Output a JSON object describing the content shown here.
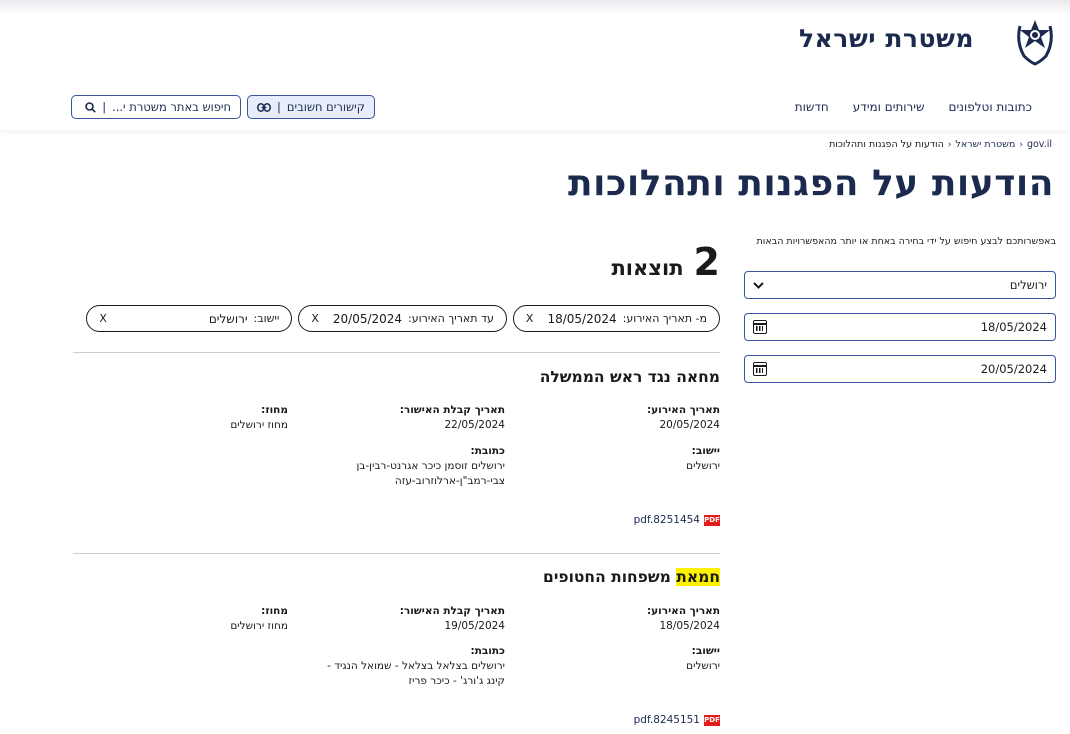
{
  "header": {
    "logo_text": "משטרת ישראל",
    "nav": [
      "כתובות וטלפונים",
      "שירותים ומידע",
      "חדשות"
    ],
    "links_button": "קישורים חשובים",
    "search_button": "חיפוש באתר משטרת י..."
  },
  "breadcrumb": [
    "gov.il",
    "משטרת ישראל",
    "הודעות על הפגנות ותהלוכות"
  ],
  "page_title": "הודעות על הפגנות ותהלוכות",
  "sidebar": {
    "hint": "באפשרותכם לבצע חיפוש על ידי בחירה באחת או יותר מהאפשרויות הבאות",
    "settlement_select": "ירושלים",
    "date_from": "18/05/2024",
    "date_to": "20/05/2024"
  },
  "results": {
    "count": "2",
    "label": "תוצאות"
  },
  "chips": [
    {
      "label": "מ- תאריך האירוע:",
      "value": "18/05/2024",
      "close": "X"
    },
    {
      "label": "עד תאריך האירוע:",
      "value": "20/05/2024",
      "close": "X"
    },
    {
      "label": "יישוב:",
      "value": "ירושלים",
      "close": "X"
    }
  ],
  "items": [
    {
      "title_rest": "מחאה נגד ראש הממשלה",
      "event_date_label": "תאריך האירוע:",
      "event_date": "20/05/2024",
      "approval_date_label": "תאריך קבלת האישור:",
      "approval_date": "22/05/2024",
      "district_label": "מחוז:",
      "district": "מחוז ירושלים",
      "settlement_label": "יישוב:",
      "settlement": "ירושלים",
      "address_label": "כתובת:",
      "address_line1": "ירושלים זוסמן כיכר אגרנט-רבין-בן",
      "address_line2": "צבי-רמב\"ן-ארלוזרוב-עזה",
      "pdf": "pdf.8251454",
      "pdf_icon": "PDF"
    },
    {
      "title_highlight": "חמאת",
      "title_rest": " משפחות החטופים",
      "event_date_label": "תאריך האירוע:",
      "event_date": "18/05/2024",
      "approval_date_label": "תאריך קבלת האישור:",
      "approval_date": "19/05/2024",
      "district_label": "מחוז:",
      "district": "מחוז ירושלים",
      "settlement_label": "יישוב:",
      "settlement": "ירושלים",
      "address_label": "כתובת:",
      "address_line1": "ירושלים בצלאל בצלאל - שמואל הנגיד -",
      "address_line2": "קינג ג'ורג' - כיכר פריז",
      "pdf": "pdf.8245151",
      "pdf_icon": "PDF"
    }
  ],
  "colors": {
    "brand": "#1b2a4e",
    "accent_border": "#3a55a0",
    "highlight": "#fff200",
    "pdf_red": "#e31b1b"
  }
}
